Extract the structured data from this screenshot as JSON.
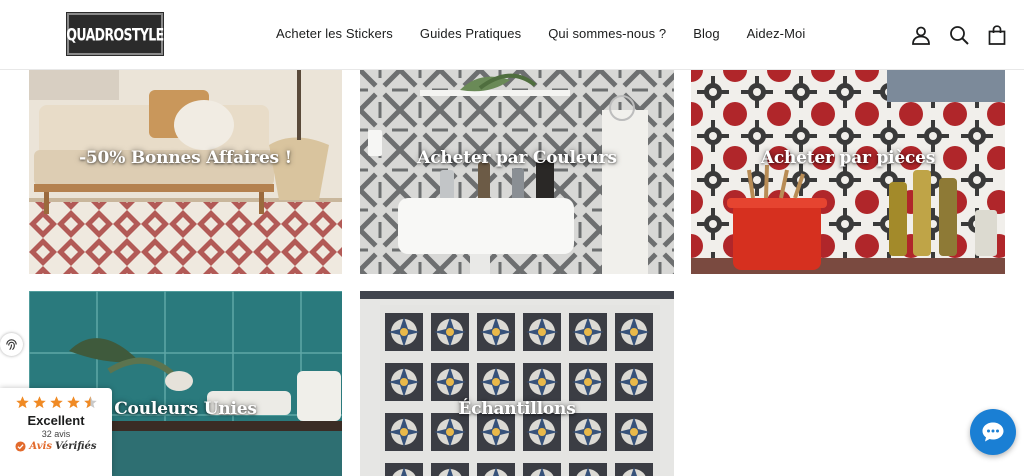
{
  "header": {
    "logo_text": "QUADROSTYLE",
    "nav": [
      {
        "label": "Acheter les Stickers"
      },
      {
        "label": "Guides Pratiques"
      },
      {
        "label": "Qui sommes-nous ?"
      },
      {
        "label": "Blog"
      },
      {
        "label": "Aidez-Moi"
      }
    ],
    "icons": [
      "account-icon",
      "search-icon",
      "cart-icon"
    ]
  },
  "tiles": [
    {
      "caption": "-50% Bonnes Affaires !"
    },
    {
      "caption": "Acheter par Couleurs"
    },
    {
      "caption": "Acheter par pièces"
    },
    {
      "caption": "Couleurs Unies"
    },
    {
      "caption": "Échantillons"
    }
  ],
  "reviews_widget": {
    "rating_label": "Excellent",
    "count": "32 avis",
    "brand_part1": "Avis",
    "brand_part2": "Vérifiés",
    "stars": 4.5,
    "star_color": "#f08a24"
  },
  "colors": {
    "chat_button": "#1a7fd4",
    "teal_tile": "#2a7a7d",
    "terracotta": "#b25a56"
  }
}
